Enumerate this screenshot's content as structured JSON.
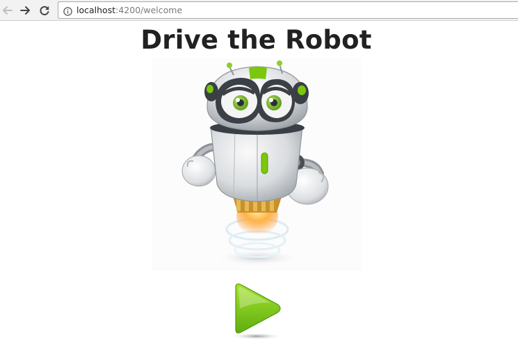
{
  "browser": {
    "url_host": "localhost",
    "url_path": ":4200/welcome",
    "icons": {
      "back": "arrow-left-icon",
      "forward": "arrow-right-icon",
      "reload": "reload-icon",
      "info": "info-icon"
    }
  },
  "page": {
    "title": "Drive the Robot",
    "hero_image": "robot-mascot-image",
    "start_control": "play-icon"
  },
  "colors": {
    "accent_green": "#7ac70c",
    "title_text": "#212121",
    "robot_body": "#d9dcdf"
  }
}
